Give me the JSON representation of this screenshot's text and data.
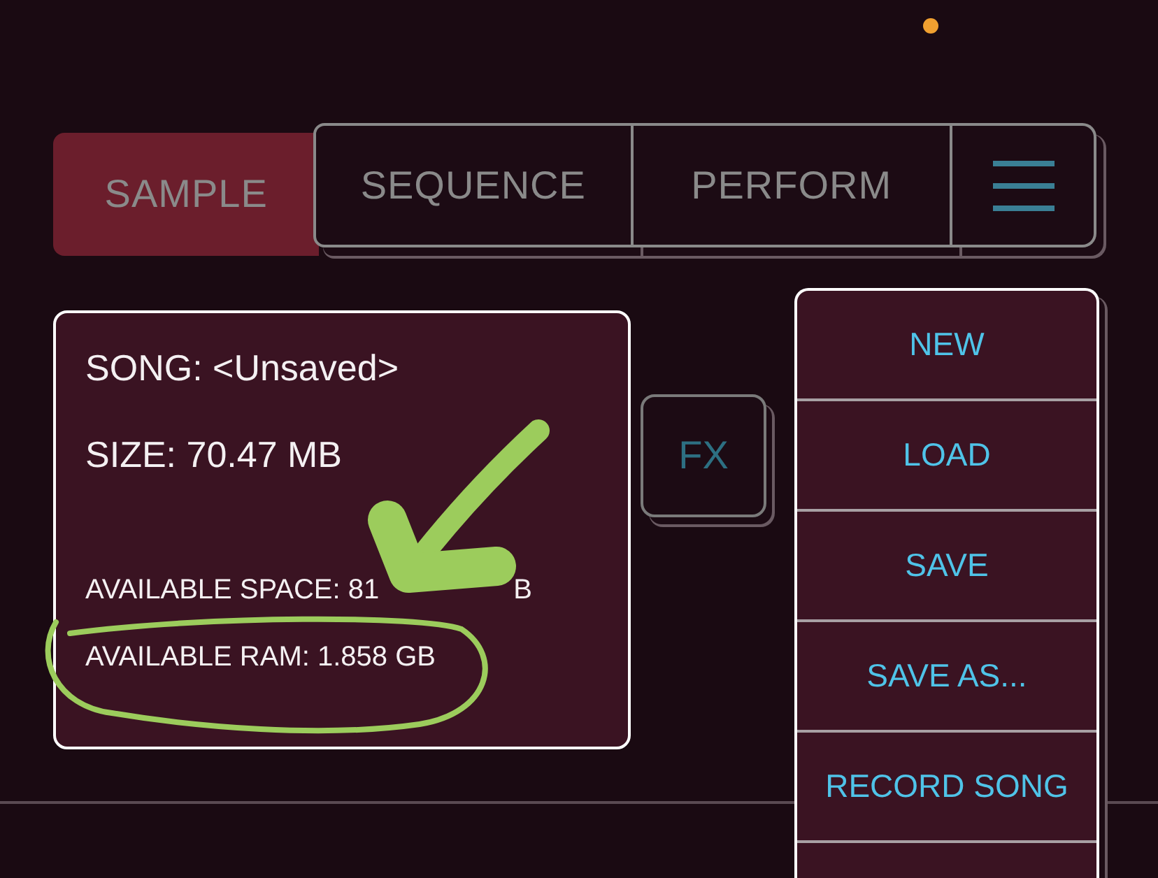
{
  "tabs": [
    {
      "label": "SAMPLE",
      "selected": true
    },
    {
      "label": "SEQUENCE",
      "selected": false
    },
    {
      "label": "PERFORM",
      "selected": false
    }
  ],
  "song_info": {
    "song": "SONG: <Unsaved>",
    "size": "SIZE: 70.47 MB",
    "available_space": "AVAILABLE SPACE: 81",
    "available_space_tail": "B",
    "available_ram": "AVAILABLE RAM: 1.858 GB"
  },
  "fx_button": {
    "label": "FX"
  },
  "file_menu": {
    "items": [
      "NEW",
      "LOAD",
      "SAVE",
      "SAVE AS...",
      "RECORD SONG"
    ]
  }
}
